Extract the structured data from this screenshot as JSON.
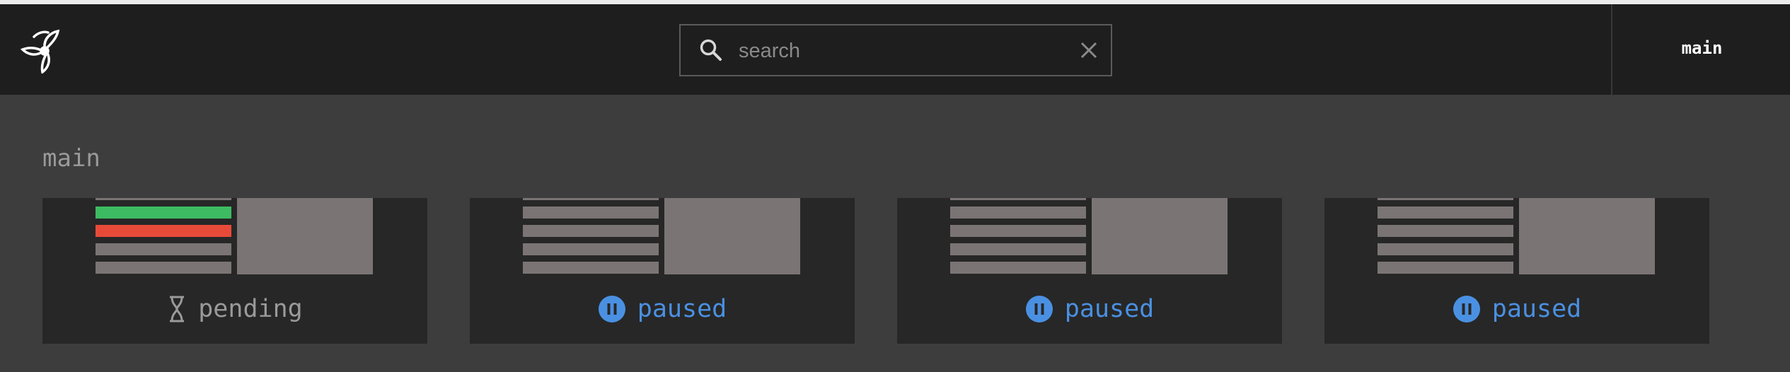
{
  "header": {
    "logo": "concourse-propeller-logo",
    "search": {
      "placeholder": "search",
      "value": ""
    },
    "team_label": "main"
  },
  "group": {
    "title": "main",
    "pipelines": [
      {
        "status": "pending",
        "status_icon": "hourglass-icon",
        "status_color": "#9a9a9a",
        "job_bars": [
          "#3dbb62",
          "#e84a3a",
          "#7a7574",
          "#7a7574"
        ]
      },
      {
        "status": "paused",
        "status_icon": "pause-circle-icon",
        "status_color": "#4a90e2",
        "job_bars": [
          "#7a7574",
          "#7a7574",
          "#7a7574",
          "#7a7574"
        ]
      },
      {
        "status": "paused",
        "status_icon": "pause-circle-icon",
        "status_color": "#4a90e2",
        "job_bars": [
          "#7a7574",
          "#7a7574",
          "#7a7574",
          "#7a7574"
        ]
      },
      {
        "status": "paused",
        "status_icon": "pause-circle-icon",
        "status_color": "#4a90e2",
        "job_bars": [
          "#7a7574",
          "#7a7574",
          "#7a7574",
          "#7a7574"
        ]
      }
    ]
  }
}
